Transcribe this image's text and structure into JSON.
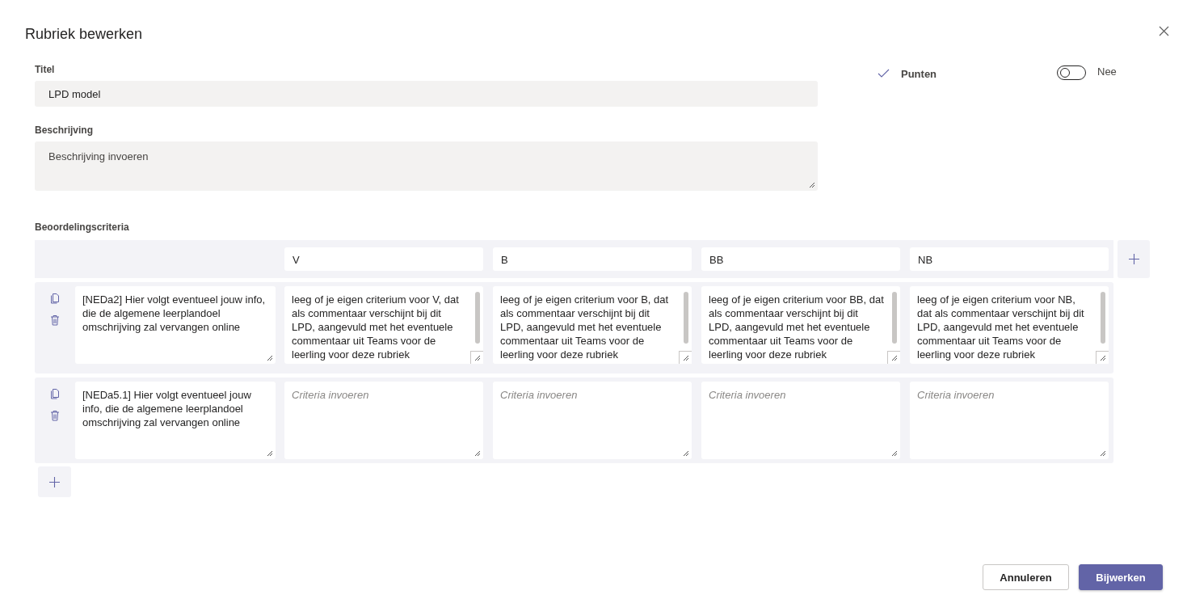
{
  "dialog": {
    "title": "Rubriek bewerken"
  },
  "fields": {
    "title": {
      "label": "Titel",
      "value": "LPD model"
    },
    "description": {
      "label": "Beschrijving",
      "placeholder": "Beschrijving invoeren"
    }
  },
  "points": {
    "label": "Punten",
    "on": false,
    "state_label": "Nee"
  },
  "criteria": {
    "label": "Beoordelingscriteria",
    "levels": [
      "V",
      "B",
      "BB",
      "NB"
    ],
    "rows": [
      {
        "description": "[NEDa2]  Hier volgt eventueel jouw info, die de algemene leerplandoel omschrijving zal vervangen online",
        "cells": [
          {
            "value": "leeg of je eigen criterium voor V, dat als commentaar verschijnt bij dit LPD, aangevuld met het eventuele commentaar uit Teams voor de leerling voor deze rubriek"
          },
          {
            "value": "leeg of je eigen criterium voor B, dat als commentaar verschijnt bij dit LPD, aangevuld met het eventuele commentaar uit Teams voor de leerling voor deze rubriek"
          },
          {
            "value": "leeg of je eigen criterium voor BB, dat als commentaar verschijnt bij dit LPD, aangevuld met het eventuele commentaar uit Teams voor de leerling voor deze rubriek"
          },
          {
            "value": "leeg of je eigen criterium voor NB, dat als commentaar verschijnt bij dit LPD, aangevuld met het eventuele commentaar uit Teams voor de leerling voor deze rubriek"
          }
        ]
      },
      {
        "description": "[NEDa5.1] Hier volgt eventueel jouw info, die de algemene leerplandoel omschrijving zal vervangen online",
        "cells": [
          {
            "placeholder": "Criteria invoeren"
          },
          {
            "placeholder": "Criteria invoeren"
          },
          {
            "placeholder": "Criteria invoeren"
          },
          {
            "placeholder": "Criteria invoeren"
          }
        ]
      }
    ]
  },
  "buttons": [
    {
      "label": "Annuleren",
      "kind": "secondary"
    },
    {
      "label": "Bijwerken",
      "kind": "primary"
    }
  ]
}
